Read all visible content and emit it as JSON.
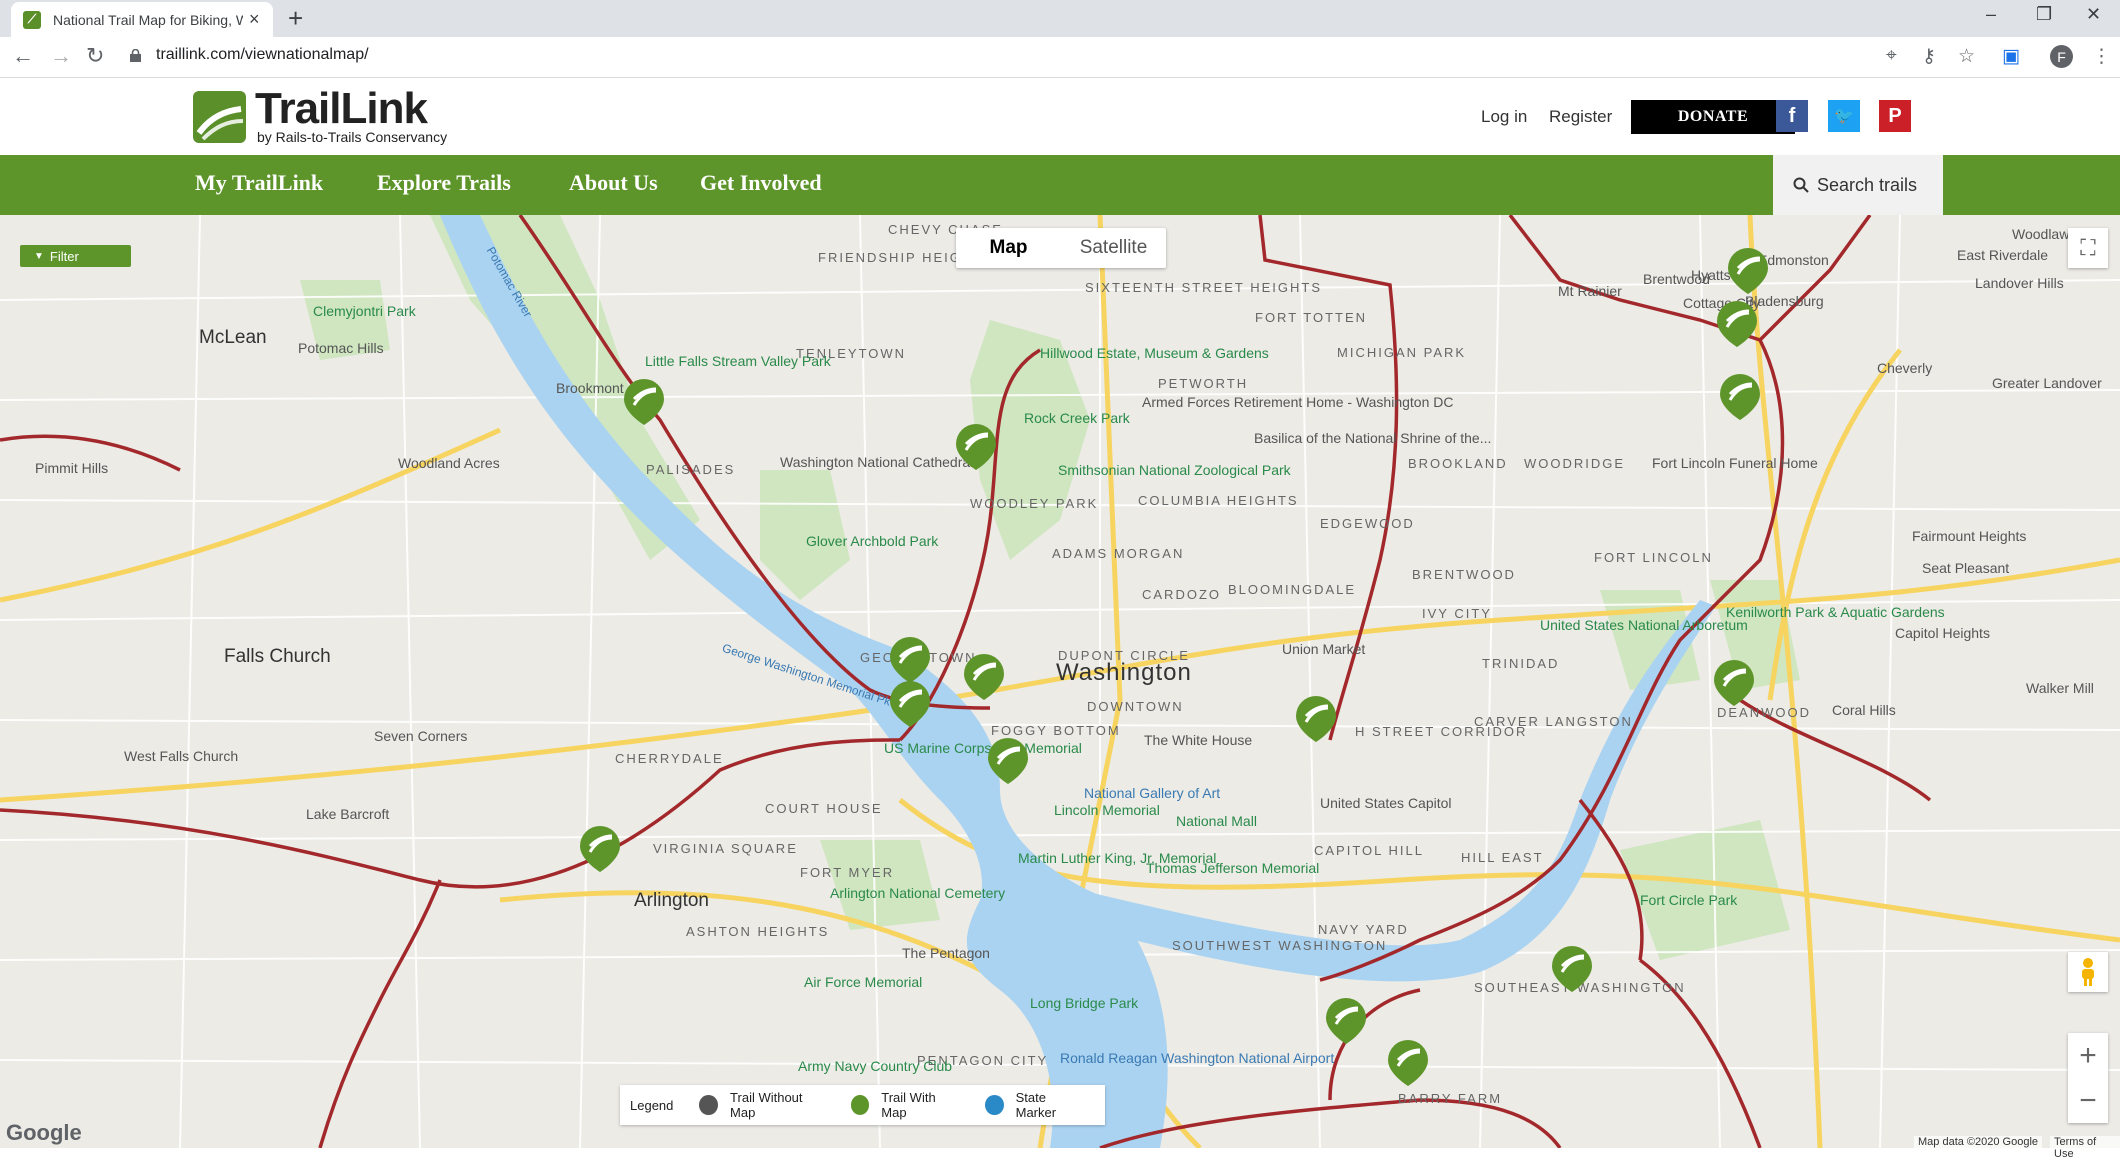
{
  "browser": {
    "tab_title": "National Trail Map for Biking, Walking...",
    "url": "traillink.com/viewnationalmap/",
    "avatar_letter": "F"
  },
  "site": {
    "logo_title": "TrailLink",
    "logo_subtitle": "by Rails-to-Trails Conservancy",
    "login": "Log in",
    "register": "Register",
    "donate": "DONATE",
    "nav": [
      "My TrailLink",
      "Explore Trails",
      "About Us",
      "Get Involved"
    ],
    "search_label": "Search trails",
    "colors": {
      "brand_green": "#5e952b",
      "trail_red": "#a3282b",
      "donate_bg": "#000000",
      "facebook": "#3b5998",
      "twitter": "#1da1f2",
      "pinterest": "#cb2027"
    }
  },
  "map": {
    "type_controls": {
      "map": "Map",
      "satellite": "Satellite",
      "selected": "Map"
    },
    "filter_label": "Filter",
    "legend": {
      "title": "Legend",
      "items": [
        {
          "label": "Trail Without Map",
          "color": "#555555"
        },
        {
          "label": "Trail With Map",
          "color": "#5e952b"
        },
        {
          "label": "State Marker",
          "color": "#2a8ac8"
        }
      ]
    },
    "attribution": "Map data ©2020 Google",
    "terms": "Terms of Use",
    "google_brand": "Google",
    "place_labels": {
      "washington": "Washington",
      "downtown": "DOWNTOWN",
      "arlington": "Arlington",
      "mclean": "McLean",
      "falls_church": "Falls Church",
      "west_falls_church": "West Falls Church",
      "seven_corners": "Seven Corners",
      "pimmit_hills": "Pimmit Hills",
      "woodland_acres": "Woodland Acres",
      "potomac_hills": "Potomac Hills",
      "lake_barcroft": "Lake Barcroft",
      "mt_rainier": "Mt Rainier",
      "brentwood": "Brentwood",
      "hyattsville": "Hyattsville",
      "cottage_city": "Cottage City",
      "bladensburg": "Bladensburg",
      "cheverly": "Cheverly",
      "landover_hills": "Landover Hills",
      "greater_landover": "Greater Landover",
      "fairmount_heights": "Fairmount Heights",
      "seat_pleasant": "Seat Pleasant",
      "capitol_heights": "Capitol Heights",
      "coral_hills": "Coral Hills",
      "walker_mill": "Walker Mill",
      "woodlawn": "Woodlawn",
      "east_riverdale": "East Riverdale",
      "edmonston": "Edmonston",
      "friendship_heights": "FRIENDSHIP HEIGHTS",
      "tenleytown": "TENLEYTOWN",
      "palisades": "PALISADES",
      "woodley_park": "WOODLEY PARK",
      "adams_morgan": "ADAMS MORGAN",
      "cardozo": "CARDOZO",
      "bloomingdale": "BLOOMINGDALE",
      "fort_totten": "FORT TOTTEN",
      "michigan_park": "MICHIGAN PARK",
      "petworth": "PETWORTH",
      "brookland": "BROOKLAND",
      "woodridge": "WOODRIDGE",
      "edgewood": "EDGEWOOD",
      "fort_lincoln": "FORT LINCOLN",
      "ivy_city": "IVY CITY",
      "trinidad": "TRINIDAD",
      "carver_langston": "CARVER LANGSTON",
      "h_street": "H STREET CORRIDOR",
      "deanwood": "DEANWOOD",
      "capitol_hill": "CAPITOL HILL",
      "hill_east": "HILL EAST",
      "navy_yard": "NAVY YARD",
      "southwest": "SOUTHWEST WASHINGTON",
      "southeast": "SOUTHEAST WASHINGTON",
      "barry_farm": "BARRY FARM",
      "foggy_bottom": "FOGGY BOTTOM",
      "dupont_circle": "DUPONT CIRCLE",
      "cherrydale": "CHERRYDALE",
      "court_house": "COURT HOUSE",
      "fort_myer": "FORT MYER",
      "virginia_square": "VIRGINIA SQUARE",
      "ashton_heights": "ASHTON HEIGHTS",
      "pentagon_city": "PENTAGON CITY",
      "columbia_heights": "COLUMBIA HEIGHTS",
      "sixteenth_street": "SIXTEENTH STREET HEIGHTS",
      "brentwood_hood": "BRENTWOOD",
      "chevy_chase": "CHEVY CHASE",
      "clemyjontri": "Clemyjontri Park",
      "white_house": "The White House",
      "pentagon": "The Pentagon",
      "us_capitol": "United States Capitol",
      "national_mall": "National Mall",
      "arlington_cemetery": "Arlington National Cemetery",
      "national_cathedral": "Washington National Cathedral",
      "zoo": "Smithsonian National Zoological Park",
      "arboretum": "United States National Arboretum",
      "union_market": "Union Market",
      "lincoln_memorial": "Lincoln Memorial",
      "jefferson_memorial": "Thomas Jefferson Memorial",
      "air_force_memorial": "Air Force Memorial",
      "gallery_of_art": "National Gallery of Art",
      "glover_archbold": "Glover Archbold Park",
      "rock_creek": "Rock Creek Park",
      "kenilworth": "Kenilworth Park & Aquatic Gardens",
      "hillwood": "Hillwood Estate, Museum & Gardens",
      "armed_forces": "Armed Forces Retirement Home - Washington DC",
      "basilica": "Basilica of the National Shrine of the...",
      "fort_lincoln_funeral": "Fort Lincoln Funeral Home",
      "marine_memorial": "US Marine Corps War Memorial",
      "mlk_memorial": "Martin Luther King, Jr. Memorial",
      "long_bridge": "Long Bridge Park",
      "army_navy": "Army Navy Country Club",
      "fort_circle": "Fort Circle Park",
      "little_falls": "Little Falls Stream Valley Park",
      "brookmont": "Brookmont",
      "georgetown": "GEORGETOWN",
      "potomac_river": "Potomac River",
      "reagan_airport": "Ronald Reagan Washington National Airport",
      "memorial_parkway": "George Washington Memorial Pkwy"
    }
  }
}
